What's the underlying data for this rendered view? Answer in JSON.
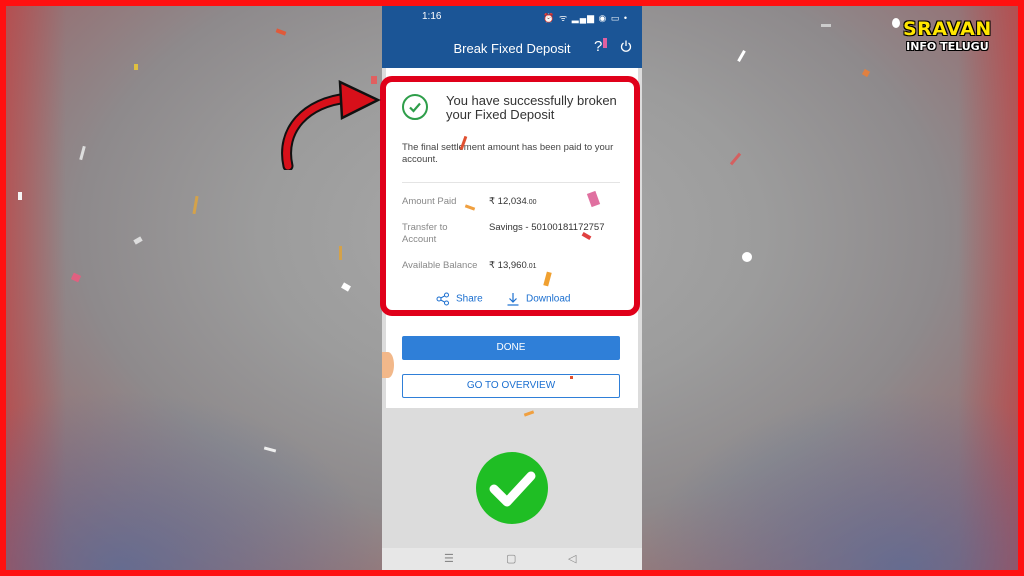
{
  "statusbar": {
    "time": "1:16",
    "icons": "⏰ ᯤ ▂▄▆ ◉ ▭ •"
  },
  "appbar": {
    "title": "Break Fixed Deposit",
    "help_label": "?"
  },
  "result": {
    "message": "You have successfully broken your Fixed Deposit",
    "description": "The final settlement amount has been paid to your account."
  },
  "details": [
    {
      "label": "Amount Paid",
      "value": "₹ 12,034",
      "decimals": ".00"
    },
    {
      "label": "Transfer to Account",
      "value": "Savings - 50100181172757",
      "decimals": ""
    },
    {
      "label": "Available Balance",
      "value": "₹ 13,960",
      "decimals": ".01"
    }
  ],
  "actions": {
    "share_label": "Share",
    "download_label": "Download"
  },
  "buttons": {
    "done_label": "DONE",
    "overview_label": "GO TO OVERVIEW"
  },
  "navbar": {
    "menu": "☰",
    "home": "▢",
    "back": "◁"
  },
  "channel_logo": {
    "line1": "SRAVAN",
    "line2": "INFO TELUGU"
  },
  "colors": {
    "frame": "#ff1010",
    "appbar": "#1b5596",
    "accent": "#2f7fd8",
    "success": "#2e9e4a",
    "highlight": "#e0001a",
    "big_check": "#1fbe24",
    "logo_yellow": "#ffe600"
  },
  "icons": [
    "check-circle-icon",
    "share-icon",
    "download-icon",
    "power-icon",
    "help-icon",
    "big-checkmark-icon",
    "red-arrow-icon"
  ]
}
